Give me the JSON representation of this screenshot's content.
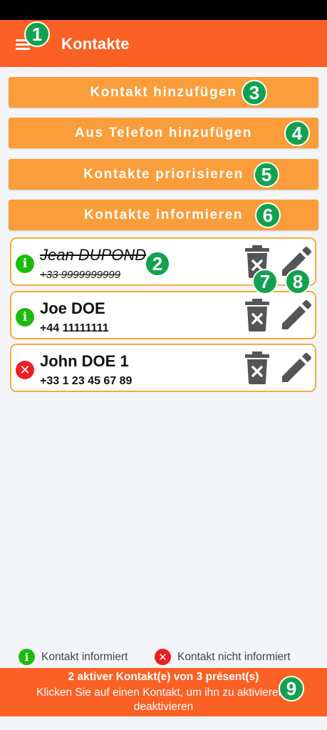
{
  "app_bar": {
    "title": "Kontakte"
  },
  "actions": {
    "add_contact": "Kontakt hinzufügen",
    "add_from_phone": "Aus Telefon hinzufügen",
    "prioritize": "Kontakte priorisieren",
    "inform": "Kontakte informieren"
  },
  "contacts": [
    {
      "name": "Jean DUPOND",
      "phone": "+33 9999999999",
      "status": "informed",
      "active": false
    },
    {
      "name": "Joe DOE",
      "phone": "+44 11111111",
      "status": "informed",
      "active": true
    },
    {
      "name": "John DOE 1",
      "phone": "+33 1 23 45 67 89",
      "status": "not_informed",
      "active": true
    }
  ],
  "legend": {
    "informed": "Kontakt informiert",
    "not_informed": "Kontakt nicht informiert",
    "informed_glyph": "i",
    "not_informed_glyph": "✕"
  },
  "footer": {
    "count": "2 aktiver Kontakt(e) von 3 présent(s)",
    "hint": "Klicken Sie auf einen Kontakt, um ihn zu aktivieren / deaktivieren"
  },
  "badges": [
    "1",
    "2",
    "3",
    "4",
    "5",
    "6",
    "7",
    "8",
    "9"
  ],
  "colors": {
    "primary": "#fb6025",
    "button": "#fb9d3a",
    "card_border": "#f2ad3d",
    "informed": "#1dbb0b",
    "not_informed": "#ec1e24",
    "badge": "#12a150"
  },
  "icons": {
    "menu": "hamburger-menu-icon",
    "delete": "trash-x-icon",
    "edit": "pencil-icon",
    "informed": "info-circle-icon",
    "not_informed": "x-circle-icon"
  }
}
